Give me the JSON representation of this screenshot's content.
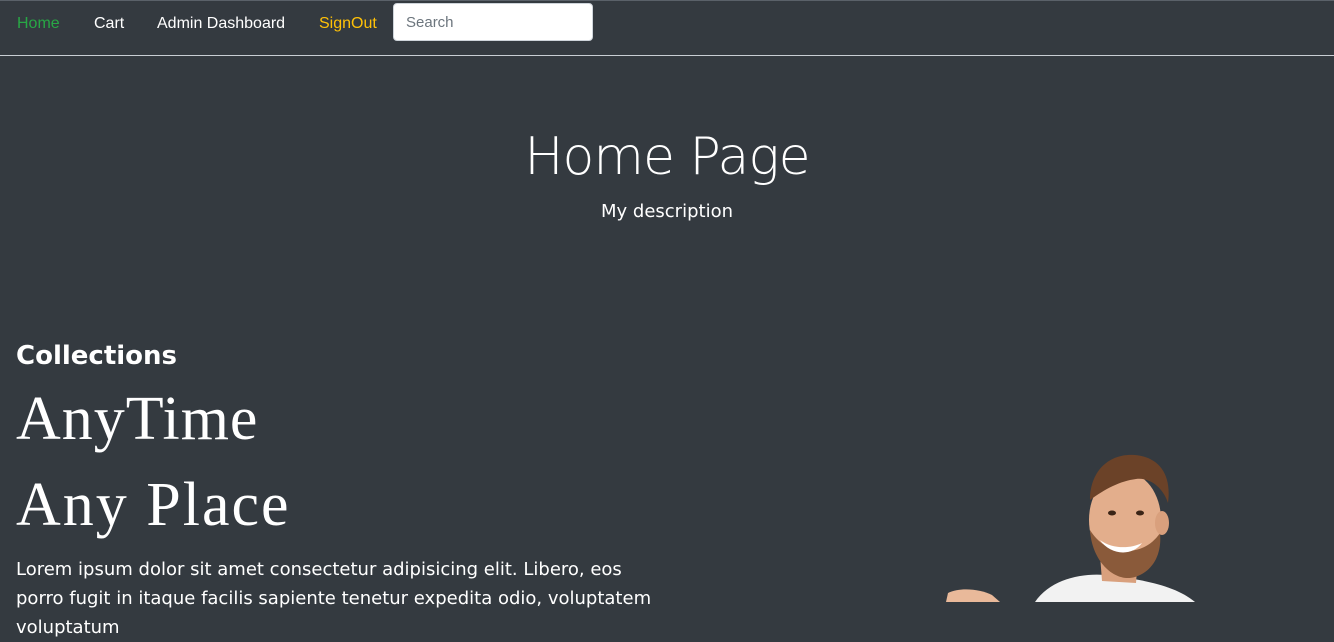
{
  "nav": {
    "home": "Home",
    "cart": "Cart",
    "admin": "Admin Dashboard",
    "signout": "SignOut",
    "search_placeholder": "Search"
  },
  "hero": {
    "title": "Home Page",
    "description": "My description"
  },
  "collections": {
    "heading": "Collections",
    "line1": "AnyTime",
    "line2": "Any Place",
    "body": "Lorem ipsum dolor sit amet consectetur adipisicing elit. Libero, eos porro fugit in itaque facilis sapiente tenetur expedita odio, voluptatem voluptatum"
  },
  "colors": {
    "background": "#343a40",
    "home_link": "#28a745",
    "signout_link": "#ffc107"
  }
}
